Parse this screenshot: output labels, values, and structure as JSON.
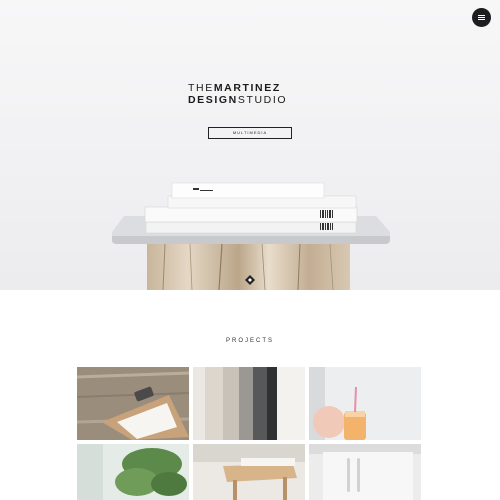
{
  "logo": {
    "line1_thin": "THE",
    "line1_bold": "MARTINEZ",
    "line2_bold": "DESIGN",
    "line2_thin": "STUDIO"
  },
  "hero": {
    "tag_button": "MULTIMEDIA"
  },
  "menu": {
    "icon": "hamburger-icon"
  },
  "scroll": {
    "icon": "diamond-arrow-down-icon"
  },
  "projects": {
    "title": "PROJECTS",
    "tiles": [
      {
        "name": "project-clipboard"
      },
      {
        "name": "project-textiles"
      },
      {
        "name": "project-drink"
      },
      {
        "name": "project-plant"
      },
      {
        "name": "project-wood-table"
      },
      {
        "name": "project-white-appliance"
      }
    ]
  }
}
